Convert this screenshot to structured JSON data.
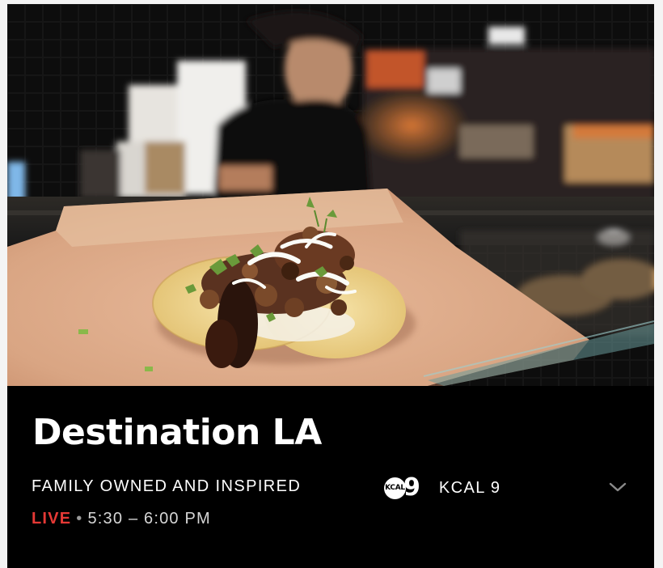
{
  "program": {
    "title": "Destination LA",
    "episode_title": "FAMILY OWNED AND INSPIRED"
  },
  "airing": {
    "status": "LIVE",
    "separator": "•",
    "time_range": "5:30 – 6:00 PM"
  },
  "channel": {
    "logo_letters": "KCAL",
    "logo_number": "9",
    "name": "KCAL 9"
  },
  "colors": {
    "live": "#e53935",
    "background": "#000000",
    "text": "#ffffff"
  },
  "icons": {
    "expand": "chevron-down-icon"
  }
}
